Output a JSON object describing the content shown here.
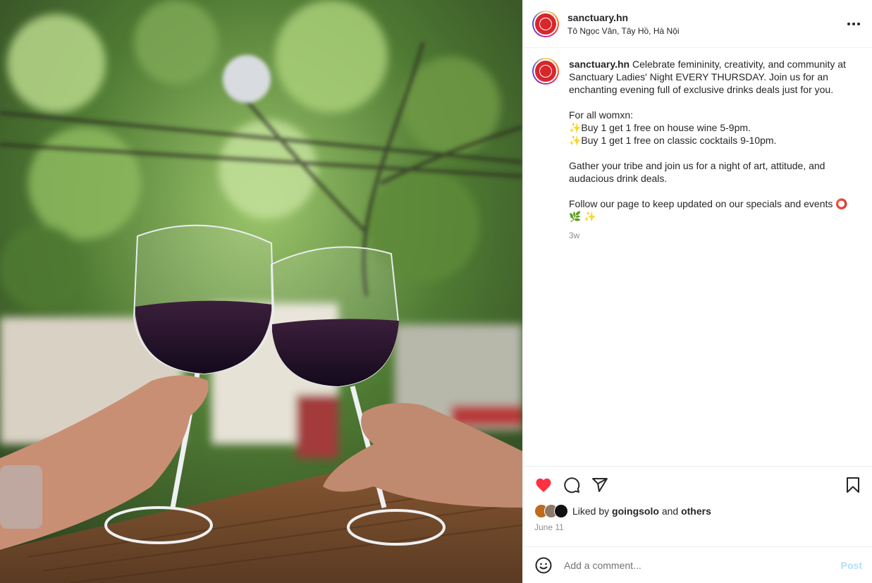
{
  "header": {
    "username": "sanctuary.hn",
    "location": "Tô Ngọc Vân, Tây Hồ, Hà Nội",
    "more_icon": "more-horizontal-icon"
  },
  "caption": {
    "username": "sanctuary.hn",
    "lines": [
      "Celebrate femininity, creativity, and community at Sanctuary Ladies' Night EVERY THURSDAY. Join us for an enchanting evening full of exclusive drinks deals just for you.",
      "",
      "For all womxn:",
      "✨Buy 1 get 1 free on house wine 5-9pm.",
      "✨Buy 1 get 1 free on classic cocktails 9-10pm.",
      "",
      "Gather your tribe and join us for a night of art, attitude, and audacious drink deals.",
      "",
      "Follow our page to keep updated on our specials and events ⭕ 🌿 ✨"
    ],
    "time_ago": "3w"
  },
  "actions": {
    "like_icon": "heart-filled-icon",
    "comment_icon": "comment-icon",
    "share_icon": "share-icon",
    "save_icon": "bookmark-icon",
    "like_color": "#ff3040"
  },
  "likes": {
    "prefix": "Liked by",
    "user": "goingsolo",
    "connector": "and",
    "others": "others"
  },
  "date": "June 11",
  "comment": {
    "placeholder": "Add a comment...",
    "post_label": "Post"
  },
  "colors": {
    "brand_red": "#d7262c",
    "post_button_disabled": "#b2dffc"
  }
}
